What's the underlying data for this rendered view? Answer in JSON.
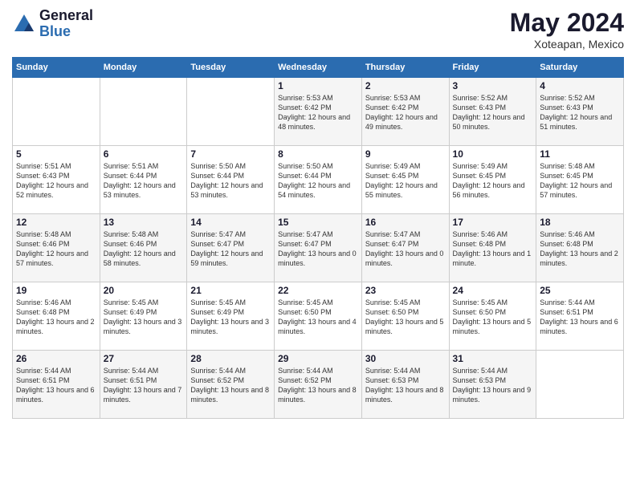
{
  "logo": {
    "line1": "General",
    "line2": "Blue"
  },
  "title": "May 2024",
  "location": "Xoteapan, Mexico",
  "weekdays": [
    "Sunday",
    "Monday",
    "Tuesday",
    "Wednesday",
    "Thursday",
    "Friday",
    "Saturday"
  ],
  "weeks": [
    [
      null,
      null,
      null,
      {
        "day": "1",
        "sunrise": "5:53 AM",
        "sunset": "6:42 PM",
        "daylight": "12 hours and 48 minutes."
      },
      {
        "day": "2",
        "sunrise": "5:53 AM",
        "sunset": "6:42 PM",
        "daylight": "12 hours and 49 minutes."
      },
      {
        "day": "3",
        "sunrise": "5:52 AM",
        "sunset": "6:43 PM",
        "daylight": "12 hours and 50 minutes."
      },
      {
        "day": "4",
        "sunrise": "5:52 AM",
        "sunset": "6:43 PM",
        "daylight": "12 hours and 51 minutes."
      }
    ],
    [
      {
        "day": "5",
        "sunrise": "5:51 AM",
        "sunset": "6:43 PM",
        "daylight": "12 hours and 52 minutes."
      },
      {
        "day": "6",
        "sunrise": "5:51 AM",
        "sunset": "6:44 PM",
        "daylight": "12 hours and 53 minutes."
      },
      {
        "day": "7",
        "sunrise": "5:50 AM",
        "sunset": "6:44 PM",
        "daylight": "12 hours and 53 minutes."
      },
      {
        "day": "8",
        "sunrise": "5:50 AM",
        "sunset": "6:44 PM",
        "daylight": "12 hours and 54 minutes."
      },
      {
        "day": "9",
        "sunrise": "5:49 AM",
        "sunset": "6:45 PM",
        "daylight": "12 hours and 55 minutes."
      },
      {
        "day": "10",
        "sunrise": "5:49 AM",
        "sunset": "6:45 PM",
        "daylight": "12 hours and 56 minutes."
      },
      {
        "day": "11",
        "sunrise": "5:48 AM",
        "sunset": "6:45 PM",
        "daylight": "12 hours and 57 minutes."
      }
    ],
    [
      {
        "day": "12",
        "sunrise": "5:48 AM",
        "sunset": "6:46 PM",
        "daylight": "12 hours and 57 minutes."
      },
      {
        "day": "13",
        "sunrise": "5:48 AM",
        "sunset": "6:46 PM",
        "daylight": "12 hours and 58 minutes."
      },
      {
        "day": "14",
        "sunrise": "5:47 AM",
        "sunset": "6:47 PM",
        "daylight": "12 hours and 59 minutes."
      },
      {
        "day": "15",
        "sunrise": "5:47 AM",
        "sunset": "6:47 PM",
        "daylight": "13 hours and 0 minutes."
      },
      {
        "day": "16",
        "sunrise": "5:47 AM",
        "sunset": "6:47 PM",
        "daylight": "13 hours and 0 minutes."
      },
      {
        "day": "17",
        "sunrise": "5:46 AM",
        "sunset": "6:48 PM",
        "daylight": "13 hours and 1 minute."
      },
      {
        "day": "18",
        "sunrise": "5:46 AM",
        "sunset": "6:48 PM",
        "daylight": "13 hours and 2 minutes."
      }
    ],
    [
      {
        "day": "19",
        "sunrise": "5:46 AM",
        "sunset": "6:48 PM",
        "daylight": "13 hours and 2 minutes."
      },
      {
        "day": "20",
        "sunrise": "5:45 AM",
        "sunset": "6:49 PM",
        "daylight": "13 hours and 3 minutes."
      },
      {
        "day": "21",
        "sunrise": "5:45 AM",
        "sunset": "6:49 PM",
        "daylight": "13 hours and 3 minutes."
      },
      {
        "day": "22",
        "sunrise": "5:45 AM",
        "sunset": "6:50 PM",
        "daylight": "13 hours and 4 minutes."
      },
      {
        "day": "23",
        "sunrise": "5:45 AM",
        "sunset": "6:50 PM",
        "daylight": "13 hours and 5 minutes."
      },
      {
        "day": "24",
        "sunrise": "5:45 AM",
        "sunset": "6:50 PM",
        "daylight": "13 hours and 5 minutes."
      },
      {
        "day": "25",
        "sunrise": "5:44 AM",
        "sunset": "6:51 PM",
        "daylight": "13 hours and 6 minutes."
      }
    ],
    [
      {
        "day": "26",
        "sunrise": "5:44 AM",
        "sunset": "6:51 PM",
        "daylight": "13 hours and 6 minutes."
      },
      {
        "day": "27",
        "sunrise": "5:44 AM",
        "sunset": "6:51 PM",
        "daylight": "13 hours and 7 minutes."
      },
      {
        "day": "28",
        "sunrise": "5:44 AM",
        "sunset": "6:52 PM",
        "daylight": "13 hours and 8 minutes."
      },
      {
        "day": "29",
        "sunrise": "5:44 AM",
        "sunset": "6:52 PM",
        "daylight": "13 hours and 8 minutes."
      },
      {
        "day": "30",
        "sunrise": "5:44 AM",
        "sunset": "6:53 PM",
        "daylight": "13 hours and 8 minutes."
      },
      {
        "day": "31",
        "sunrise": "5:44 AM",
        "sunset": "6:53 PM",
        "daylight": "13 hours and 9 minutes."
      },
      null
    ]
  ]
}
